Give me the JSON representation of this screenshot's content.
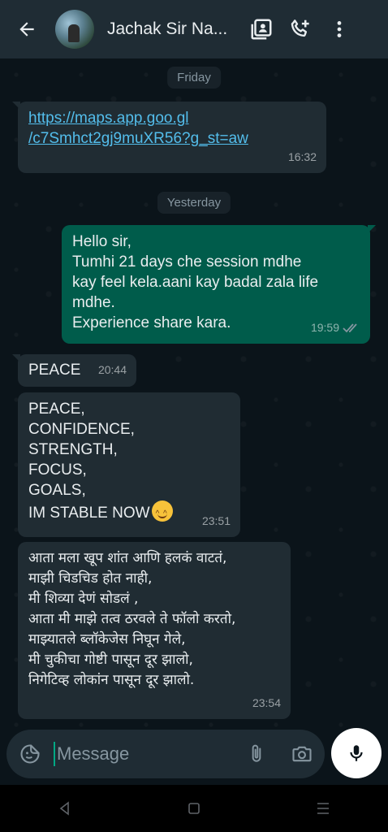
{
  "header": {
    "contact_name": "Jachak Sir Na...",
    "icons": [
      "back-arrow-icon",
      "contact-card-icon",
      "add-call-icon",
      "more-vert-icon"
    ]
  },
  "chat": {
    "date_friday": "Friday",
    "date_yesterday": "Yesterday",
    "messages": [
      {
        "direction": "incoming",
        "lines": [
          "https://maps.app.goo.gl",
          "/c7Smhct2gj9muXR56?g_st=aw"
        ],
        "time": "16:32"
      },
      {
        "direction": "outgoing",
        "lines": [
          "Hello sir,",
          "Tumhi 21 days che session mdhe",
          "kay feel kela.aani kay badal zala life",
          "mdhe.",
          "Experience share kara."
        ],
        "time": "19:59",
        "status": "read"
      },
      {
        "direction": "incoming",
        "lines": [
          "PEACE"
        ],
        "time": "20:44"
      },
      {
        "direction": "incoming",
        "lines": [
          "PEACE,",
          "CONFIDENCE,",
          "STRENGTH,",
          "FOCUS,",
          "GOALS,",
          "IM STABLE NOW"
        ],
        "emoji": "smiling-face-icon",
        "time": "23:51"
      },
      {
        "direction": "incoming",
        "lines": [
          "आता मला खूप शांत आणि हलकं वाटतं,",
          "माझी चिडचिड होत नाही,",
          "मी शिव्या देणं सोडलं ,",
          "आता मी माझे तत्व ठरवले ते फॉलो करतो,",
          "माझ्यातले ब्लॉकेजेस निघून गेले,",
          "मी चुकीचा गोष्टी पासून दूर झालो,",
          "निगेटिव्ह लोकांन पासून दूर झालो."
        ],
        "time": "23:54"
      }
    ]
  },
  "composer": {
    "placeholder": "Message"
  },
  "colors": {
    "background": "#0b141a",
    "header": "#1f2c34",
    "incoming_bubble": "#202c33",
    "outgoing_bubble": "#005c4b",
    "link": "#53bdeb",
    "read_ticks": "#8696a0"
  }
}
